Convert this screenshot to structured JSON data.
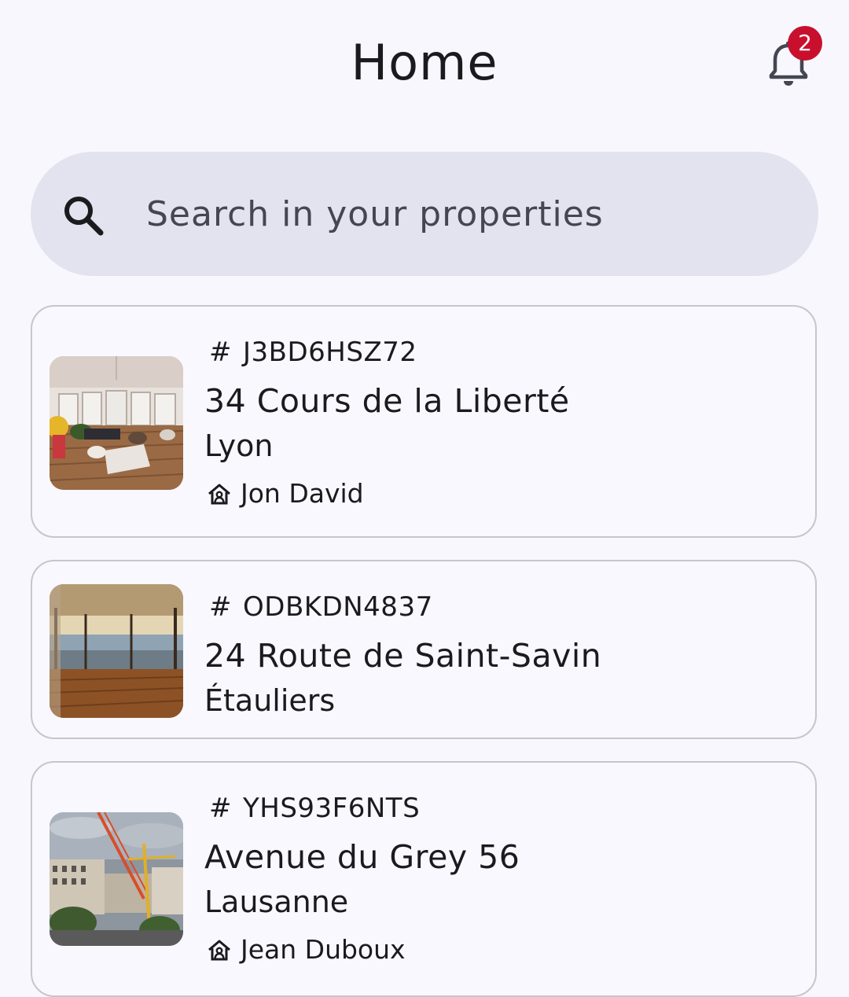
{
  "header": {
    "title": "Home",
    "notification_count": "2"
  },
  "search": {
    "placeholder": "Search in your properties"
  },
  "properties": [
    {
      "ref": "J3BD6HSZ72",
      "street": "34 Cours de la Liberté",
      "city": "Lyon",
      "owner": "Jon David"
    },
    {
      "ref": "ODBKDN4837",
      "street": "24 Route de Saint-Savin",
      "city": "Étauliers"
    },
    {
      "ref": "YHS93F6NTS",
      "street": "Avenue du Grey 56",
      "city": "Lausanne",
      "owner": "Jean Duboux"
    }
  ],
  "icons": {
    "bell": "bell-icon",
    "search": "search-icon",
    "owner": "home-user-icon"
  },
  "colors": {
    "background": "#f8f7fd",
    "search_bg": "#e2e3ee",
    "badge": "#c8102e",
    "card_border": "#c6c5d0"
  }
}
